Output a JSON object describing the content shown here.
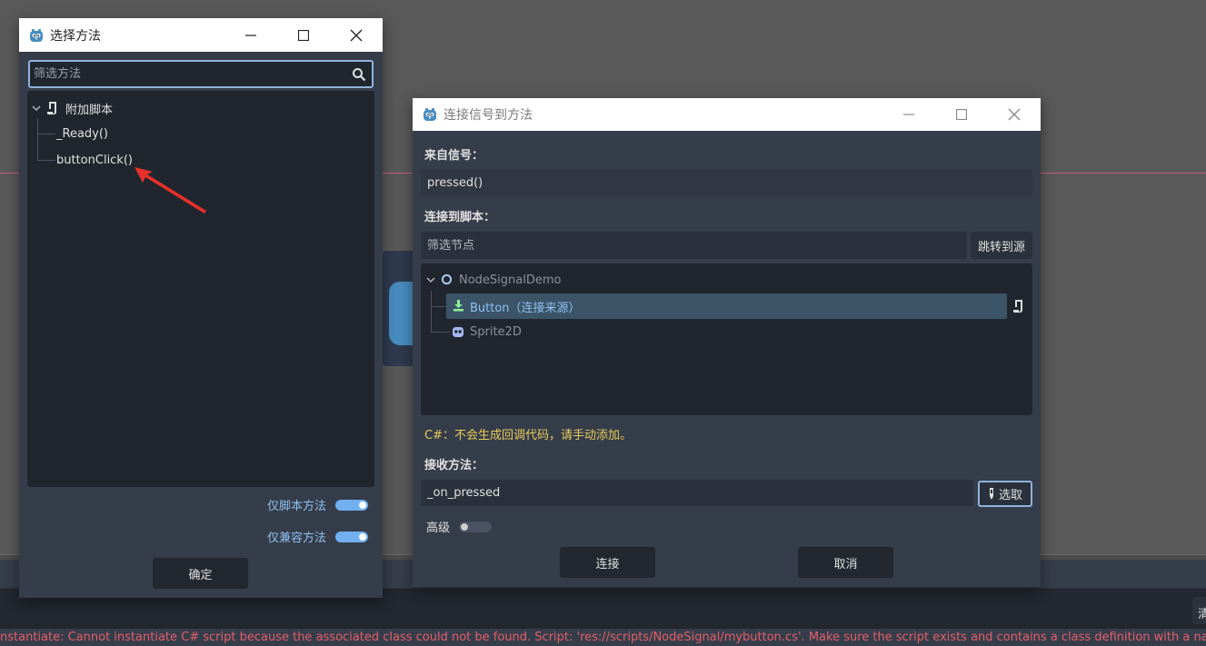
{
  "background": {
    "clear_label": "清",
    "error_text": "nstantiate: Cannot instantiate C# script because the associated class could not be found. Script: 'res://scripts/NodeSignal/mybutton.cs'. Make sure the script exists and contains a class definition with a na"
  },
  "select_method_dialog": {
    "title": "选择方法",
    "search_placeholder": "筛选方法",
    "tree": {
      "root_label": "附加脚本",
      "items": [
        "_Ready()",
        "buttonClick()"
      ]
    },
    "script_only_label": "仅脚本方法",
    "compatible_only_label": "仅兼容方法",
    "script_only_on": true,
    "compatible_only_on": true,
    "ok_label": "确定"
  },
  "connect_dialog": {
    "title": "连接信号到方法",
    "from_signal_label": "来自信号：",
    "signal_value": "pressed()",
    "connect_to_script_label": "连接到脚本：",
    "filter_nodes_placeholder": "筛选节点",
    "goto_source_label": "跳转到源",
    "tree": {
      "root": "NodeSignalDemo",
      "selected_item": "Button（连接来源）",
      "other_item": "Sprite2D"
    },
    "warning": "C#：不会生成回调代码，请手动添加。",
    "receiver_method_label": "接收方法：",
    "method_value": "_on_pressed",
    "pick_label": "选取",
    "advanced_label": "高级",
    "advanced_on": false,
    "connect_label": "连接",
    "cancel_label": "取消"
  },
  "colors": {
    "panel": "#363d4a",
    "field": "#21262e",
    "accent": "#70b0f0",
    "selection": "#3b5468",
    "warning": "#e8cc5a",
    "error": "#e45f6a",
    "annotation_arrow": "#e8302a"
  }
}
